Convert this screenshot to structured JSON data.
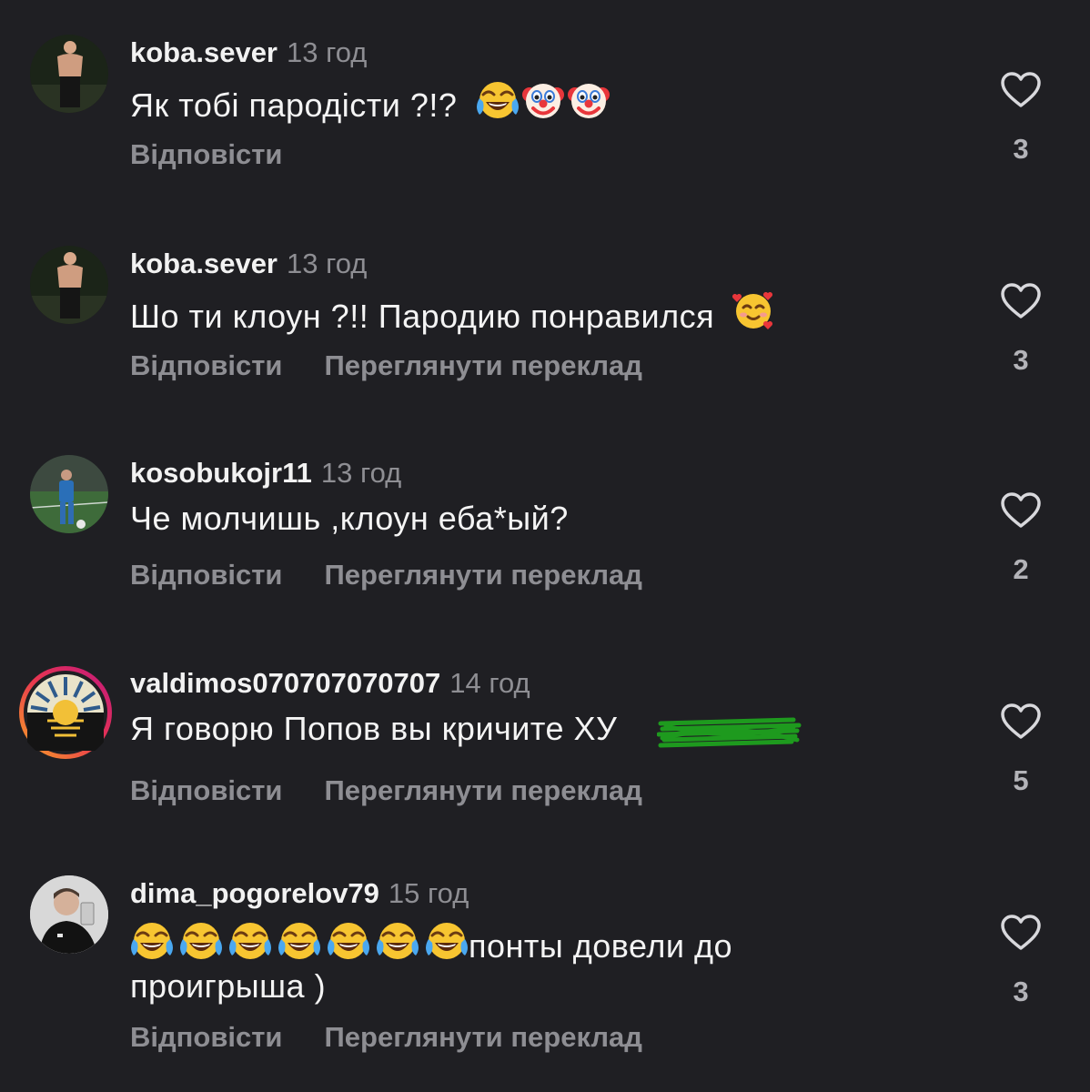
{
  "labels": {
    "reply": "Відповісти",
    "translate": "Переглянути переклад"
  },
  "colors": {
    "background": "#1f1f23",
    "secondary_text": "#8e8e93",
    "primary_text": "#f2f2f2",
    "censor_green": "#1e9a1e"
  },
  "comments": [
    {
      "username": "koba.sever",
      "time": "13 год",
      "text": "Як тобі пародісти ?!?",
      "emojis": [
        "face-with-tears-of-joy",
        "clown-face",
        "clown-face"
      ],
      "likes": "3",
      "has_translate": false
    },
    {
      "username": "koba.sever",
      "time": "13 год",
      "text": "Шо ти клоун ?!! Пародию понравился",
      "emojis": [
        "smiling-face-with-hearts"
      ],
      "likes": "3",
      "has_translate": true
    },
    {
      "username": "kosobukojr11",
      "time": "13 год",
      "text": "Че молчишь ,клоун еба*ый?",
      "likes": "2",
      "has_translate": true
    },
    {
      "username": "valdimos070707070707",
      "time": "14 год",
      "text": "Я говорю Попов вы кричите ХУ",
      "likes": "5",
      "has_translate": true,
      "avatar_has_story_ring": true
    },
    {
      "username": "dima_pogorelov79",
      "time": "15 год",
      "text_line1": "понты довели до",
      "text_line2": "проигрыша )",
      "emojis": [
        "face-with-tears-of-joy",
        "face-with-tears-of-joy",
        "face-with-tears-of-joy",
        "face-with-tears-of-joy",
        "face-with-tears-of-joy",
        "face-with-tears-of-joy",
        "face-with-tears-of-joy"
      ],
      "likes": "3",
      "has_translate": true
    }
  ]
}
